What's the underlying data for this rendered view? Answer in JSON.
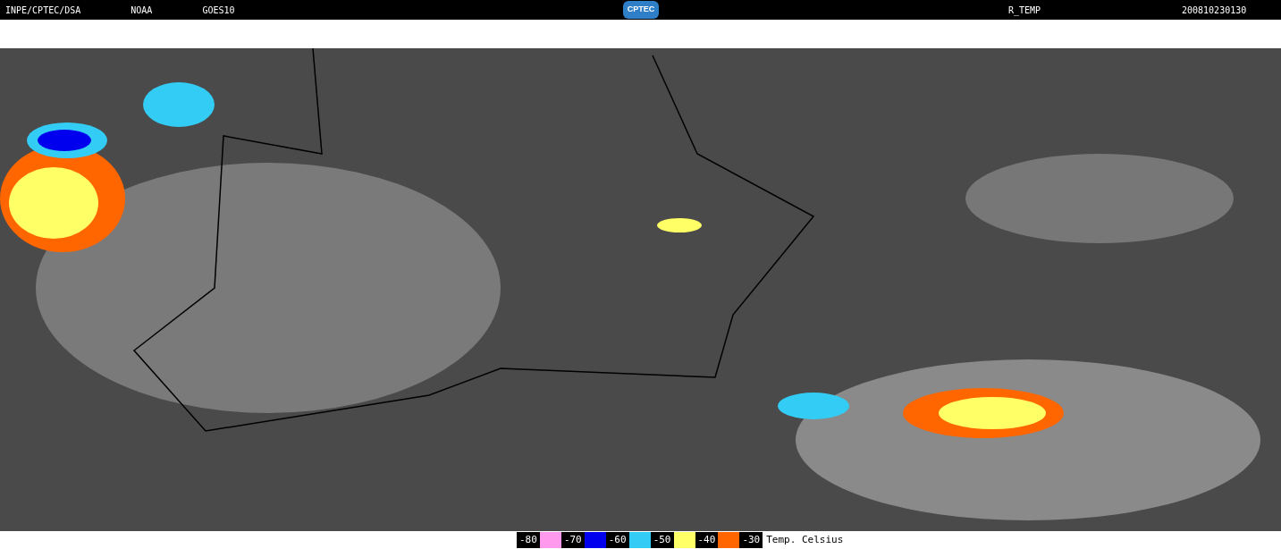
{
  "header": {
    "left": [
      "INPE/CPTEC/DSA",
      "NOAA",
      "GOES10"
    ],
    "logo": "CPTEC",
    "product": "R_TEMP",
    "timestamp": "200810230130"
  },
  "legend": {
    "steps": [
      {
        "label": "-80",
        "color": "#ff99ee"
      },
      {
        "label": "-70",
        "color": "#0000ee"
      },
      {
        "label": "-60",
        "color": "#33ccf5"
      },
      {
        "label": "-50",
        "color": "#ffff66"
      },
      {
        "label": "-40",
        "color": "#ff6600"
      },
      {
        "label": "-30"
      }
    ],
    "title": "Temp. Celsius"
  }
}
